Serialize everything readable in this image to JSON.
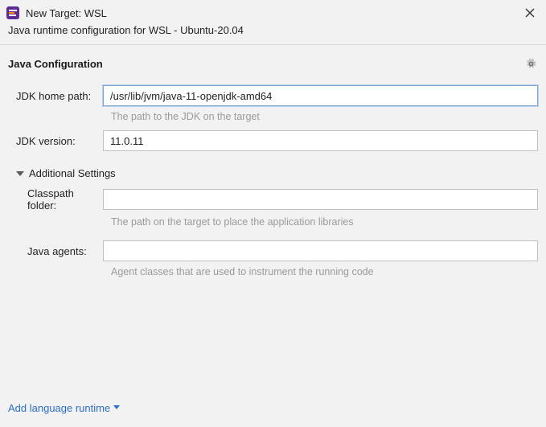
{
  "title": "New Target: WSL",
  "subtitle": "Java runtime configuration for WSL - Ubuntu-20.04",
  "section": {
    "title": "Java Configuration"
  },
  "form": {
    "jdk_home": {
      "label": "JDK home path:",
      "value": "/usr/lib/jvm/java-11-openjdk-amd64",
      "hint": "The path to the JDK on the target"
    },
    "jdk_version": {
      "label": "JDK version:",
      "value": "11.0.11"
    },
    "additional": {
      "label": "Additional Settings",
      "classpath": {
        "label": "Classpath folder:",
        "value": "",
        "hint": "The path on the target to place the application libraries"
      },
      "agents": {
        "label": "Java agents:",
        "value": "",
        "hint": "Agent classes that are used to instrument the running code"
      }
    }
  },
  "footer": {
    "add_runtime": "Add language runtime"
  }
}
